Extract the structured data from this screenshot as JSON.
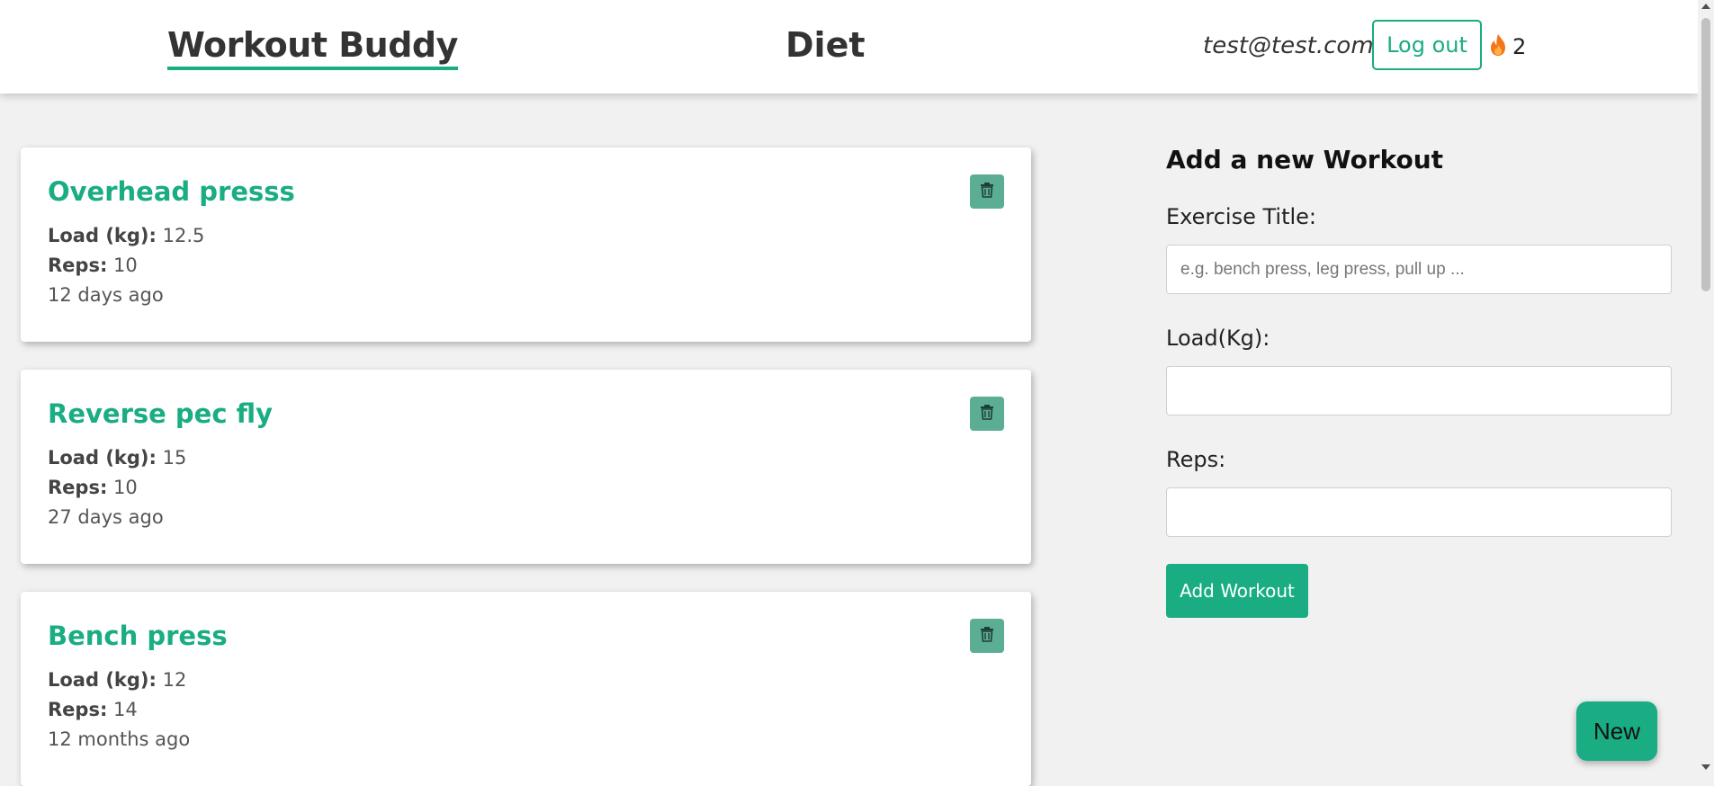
{
  "header": {
    "brand": "Workout Buddy",
    "nav_diet": "Diet",
    "user_email": "test@test.com",
    "logout_label": "Log out",
    "streak_icon": "flame-icon",
    "streak_count": "2"
  },
  "workouts": [
    {
      "title": "Overhead presss",
      "load_label": "Load (kg):",
      "load": "12.5",
      "reps_label": "Reps:",
      "reps": "10",
      "age": "12 days ago"
    },
    {
      "title": "Reverse pec fly",
      "load_label": "Load (kg):",
      "load": "15",
      "reps_label": "Reps:",
      "reps": "10",
      "age": "27 days ago"
    },
    {
      "title": "Bench press",
      "load_label": "Load (kg):",
      "load": "12",
      "reps_label": "Reps:",
      "reps": "14",
      "age": "12 months ago"
    }
  ],
  "form": {
    "heading": "Add a new Workout",
    "title_label": "Exercise Title:",
    "title_placeholder": "e.g. bench press, leg press, pull up ...",
    "title_value": "",
    "load_label": "Load(Kg):",
    "load_value": "",
    "reps_label": "Reps:",
    "reps_value": "",
    "submit_label": "Add Workout"
  },
  "fab": {
    "label": "New"
  },
  "colors": {
    "accent": "#1aac83",
    "delete_button": "#5bae94",
    "background": "#f1f1f1"
  }
}
